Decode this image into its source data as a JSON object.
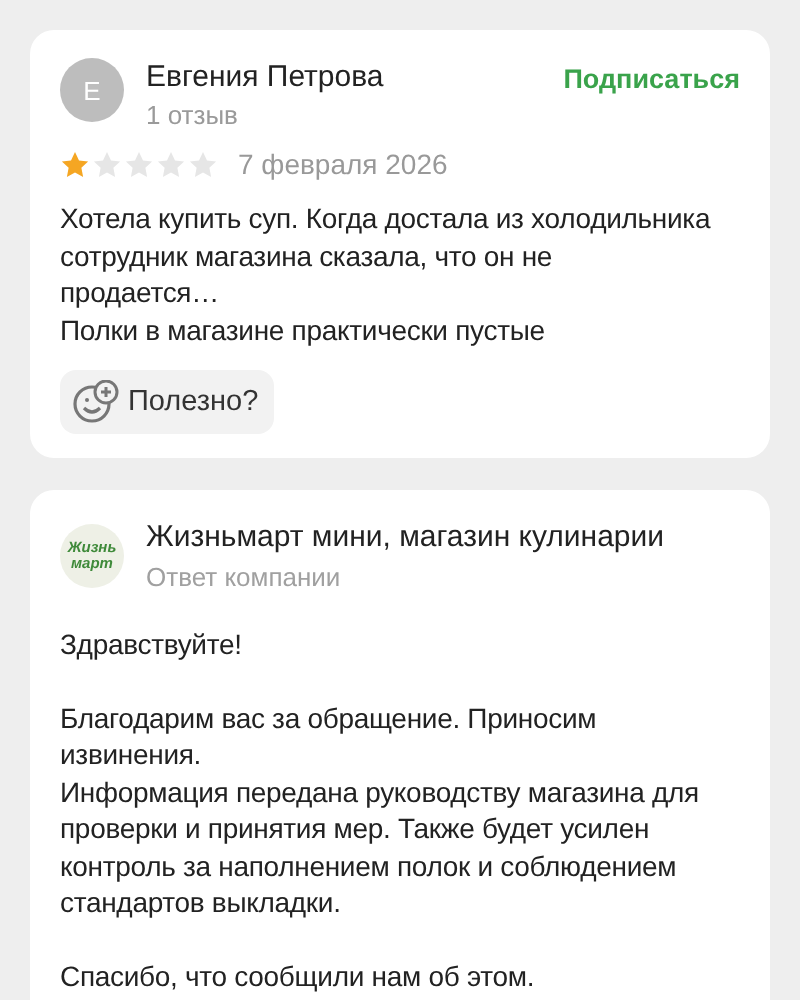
{
  "review": {
    "avatar_letter": "E",
    "author": "Евгения Петрова",
    "review_count": "1 отзыв",
    "subscribe": "Подписаться",
    "stars": 1,
    "date": "7 февраля 2026",
    "text": "Хотела купить суп. Когда достала из холодильника сотрудник магазина сказала, что он не продается…\nПолки в магазине практически пустые",
    "helpful": "Полезно?"
  },
  "reply": {
    "logo_lines": [
      "Жизнь",
      "март"
    ],
    "company": "Жизньмарт мини, магазин кулинарии",
    "label": "Ответ компании",
    "paragraphs": [
      "Здравствуйте!",
      "Благодарим вас за обращение. Приносим извинения.\nИнформация передана руководству магазина для проверки и принятия мер. Также будет усилен контроль за наполнением полок и соблюдением стандартов выкладки.",
      "Спасибо, что сообщили нам об этом."
    ]
  }
}
